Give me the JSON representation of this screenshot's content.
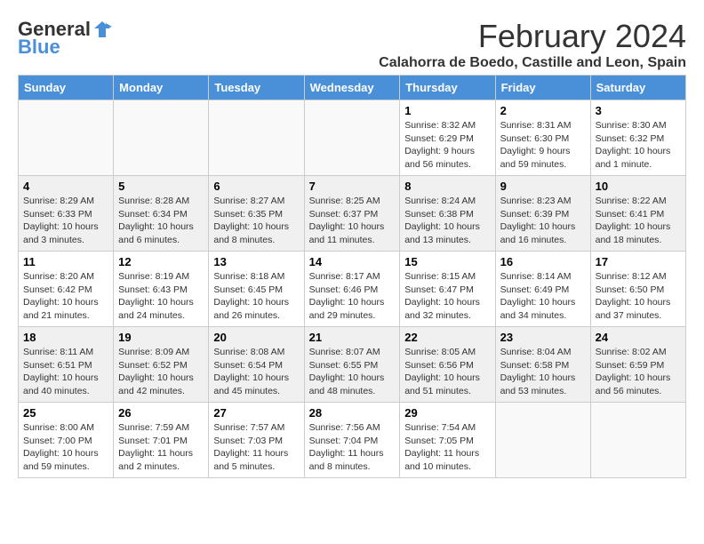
{
  "logo": {
    "general": "General",
    "blue": "Blue"
  },
  "title": "February 2024",
  "subtitle": "Calahorra de Boedo, Castille and Leon, Spain",
  "headers": [
    "Sunday",
    "Monday",
    "Tuesday",
    "Wednesday",
    "Thursday",
    "Friday",
    "Saturday"
  ],
  "weeks": [
    [
      {
        "day": "",
        "info": ""
      },
      {
        "day": "",
        "info": ""
      },
      {
        "day": "",
        "info": ""
      },
      {
        "day": "",
        "info": ""
      },
      {
        "day": "1",
        "info": "Sunrise: 8:32 AM\nSunset: 6:29 PM\nDaylight: 9 hours and 56 minutes."
      },
      {
        "day": "2",
        "info": "Sunrise: 8:31 AM\nSunset: 6:30 PM\nDaylight: 9 hours and 59 minutes."
      },
      {
        "day": "3",
        "info": "Sunrise: 8:30 AM\nSunset: 6:32 PM\nDaylight: 10 hours and 1 minute."
      }
    ],
    [
      {
        "day": "4",
        "info": "Sunrise: 8:29 AM\nSunset: 6:33 PM\nDaylight: 10 hours and 3 minutes."
      },
      {
        "day": "5",
        "info": "Sunrise: 8:28 AM\nSunset: 6:34 PM\nDaylight: 10 hours and 6 minutes."
      },
      {
        "day": "6",
        "info": "Sunrise: 8:27 AM\nSunset: 6:35 PM\nDaylight: 10 hours and 8 minutes."
      },
      {
        "day": "7",
        "info": "Sunrise: 8:25 AM\nSunset: 6:37 PM\nDaylight: 10 hours and 11 minutes."
      },
      {
        "day": "8",
        "info": "Sunrise: 8:24 AM\nSunset: 6:38 PM\nDaylight: 10 hours and 13 minutes."
      },
      {
        "day": "9",
        "info": "Sunrise: 8:23 AM\nSunset: 6:39 PM\nDaylight: 10 hours and 16 minutes."
      },
      {
        "day": "10",
        "info": "Sunrise: 8:22 AM\nSunset: 6:41 PM\nDaylight: 10 hours and 18 minutes."
      }
    ],
    [
      {
        "day": "11",
        "info": "Sunrise: 8:20 AM\nSunset: 6:42 PM\nDaylight: 10 hours and 21 minutes."
      },
      {
        "day": "12",
        "info": "Sunrise: 8:19 AM\nSunset: 6:43 PM\nDaylight: 10 hours and 24 minutes."
      },
      {
        "day": "13",
        "info": "Sunrise: 8:18 AM\nSunset: 6:45 PM\nDaylight: 10 hours and 26 minutes."
      },
      {
        "day": "14",
        "info": "Sunrise: 8:17 AM\nSunset: 6:46 PM\nDaylight: 10 hours and 29 minutes."
      },
      {
        "day": "15",
        "info": "Sunrise: 8:15 AM\nSunset: 6:47 PM\nDaylight: 10 hours and 32 minutes."
      },
      {
        "day": "16",
        "info": "Sunrise: 8:14 AM\nSunset: 6:49 PM\nDaylight: 10 hours and 34 minutes."
      },
      {
        "day": "17",
        "info": "Sunrise: 8:12 AM\nSunset: 6:50 PM\nDaylight: 10 hours and 37 minutes."
      }
    ],
    [
      {
        "day": "18",
        "info": "Sunrise: 8:11 AM\nSunset: 6:51 PM\nDaylight: 10 hours and 40 minutes."
      },
      {
        "day": "19",
        "info": "Sunrise: 8:09 AM\nSunset: 6:52 PM\nDaylight: 10 hours and 42 minutes."
      },
      {
        "day": "20",
        "info": "Sunrise: 8:08 AM\nSunset: 6:54 PM\nDaylight: 10 hours and 45 minutes."
      },
      {
        "day": "21",
        "info": "Sunrise: 8:07 AM\nSunset: 6:55 PM\nDaylight: 10 hours and 48 minutes."
      },
      {
        "day": "22",
        "info": "Sunrise: 8:05 AM\nSunset: 6:56 PM\nDaylight: 10 hours and 51 minutes."
      },
      {
        "day": "23",
        "info": "Sunrise: 8:04 AM\nSunset: 6:58 PM\nDaylight: 10 hours and 53 minutes."
      },
      {
        "day": "24",
        "info": "Sunrise: 8:02 AM\nSunset: 6:59 PM\nDaylight: 10 hours and 56 minutes."
      }
    ],
    [
      {
        "day": "25",
        "info": "Sunrise: 8:00 AM\nSunset: 7:00 PM\nDaylight: 10 hours and 59 minutes."
      },
      {
        "day": "26",
        "info": "Sunrise: 7:59 AM\nSunset: 7:01 PM\nDaylight: 11 hours and 2 minutes."
      },
      {
        "day": "27",
        "info": "Sunrise: 7:57 AM\nSunset: 7:03 PM\nDaylight: 11 hours and 5 minutes."
      },
      {
        "day": "28",
        "info": "Sunrise: 7:56 AM\nSunset: 7:04 PM\nDaylight: 11 hours and 8 minutes."
      },
      {
        "day": "29",
        "info": "Sunrise: 7:54 AM\nSunset: 7:05 PM\nDaylight: 11 hours and 10 minutes."
      },
      {
        "day": "",
        "info": ""
      },
      {
        "day": "",
        "info": ""
      }
    ]
  ]
}
